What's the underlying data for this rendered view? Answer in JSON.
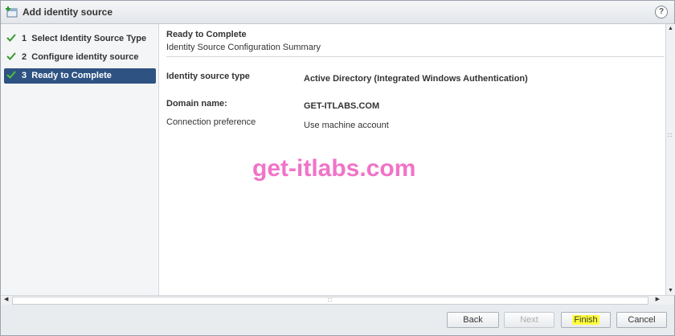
{
  "window": {
    "title": "Add identity source",
    "help_label": "?"
  },
  "steps": [
    {
      "number": "1",
      "label": "Select Identity Source Type",
      "completed": true,
      "active": false
    },
    {
      "number": "2",
      "label": "Configure identity source",
      "completed": true,
      "active": false
    },
    {
      "number": "3",
      "label": "Ready to Complete",
      "completed": true,
      "active": true
    }
  ],
  "content": {
    "title": "Ready to Complete",
    "subtitle": "Identity Source Configuration Summary",
    "fields": [
      {
        "label": "Identity source type",
        "value": "Active Directory (Integrated Windows Authentication)"
      },
      {
        "label": "Domain name:",
        "value": "GET-ITLABS.COM"
      },
      {
        "label": "Connection preference",
        "value": "Use machine account"
      }
    ],
    "watermark": "get-itlabs.com"
  },
  "footer": {
    "back_label": "Back",
    "next_label": "Next",
    "finish_label": "Finish",
    "cancel_label": "Cancel"
  },
  "colors": {
    "check": "#3a9a2e",
    "active_step": "#2e5383",
    "watermark": "#f068c4",
    "finish_highlight": "#ffff3a"
  }
}
